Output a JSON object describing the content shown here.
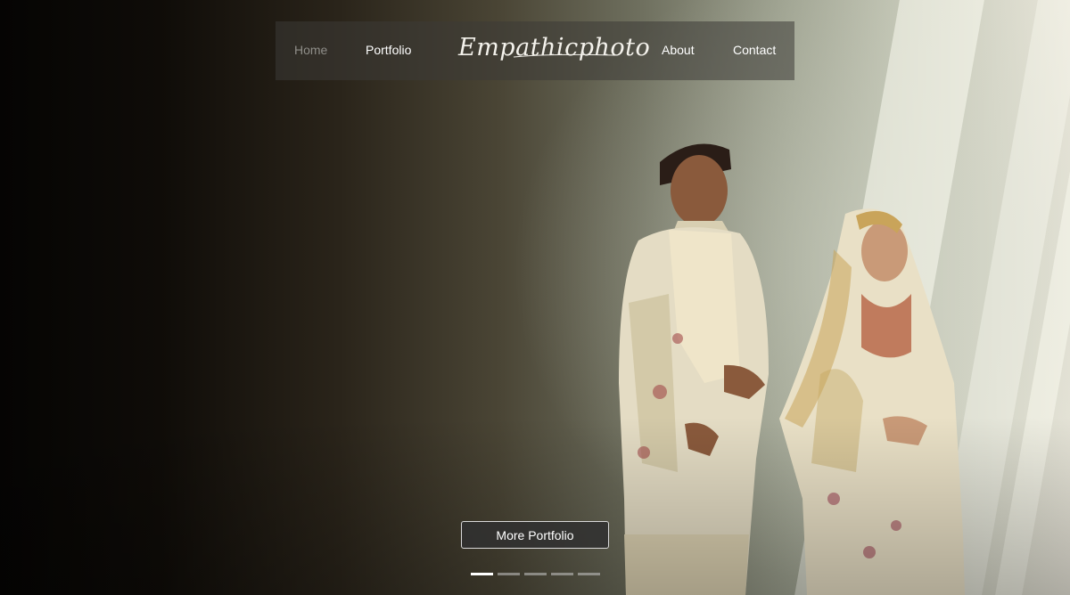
{
  "nav": {
    "home_label": "Home",
    "portfolio_label": "Portfolio",
    "logo_text": "Empathicphoto",
    "about_label": "About",
    "contact_label": "Contact",
    "active_item": "Home"
  },
  "hero": {
    "cta_label": "More Portfolio"
  },
  "carousel": {
    "slide_count": 5,
    "active_index": 0
  },
  "colors": {
    "nav_background": "#3c3a36",
    "nav_inactive_text": "#8f8e89",
    "text": "#ffffff",
    "button_background": "#303030",
    "button_border": "#d9d9d9"
  }
}
